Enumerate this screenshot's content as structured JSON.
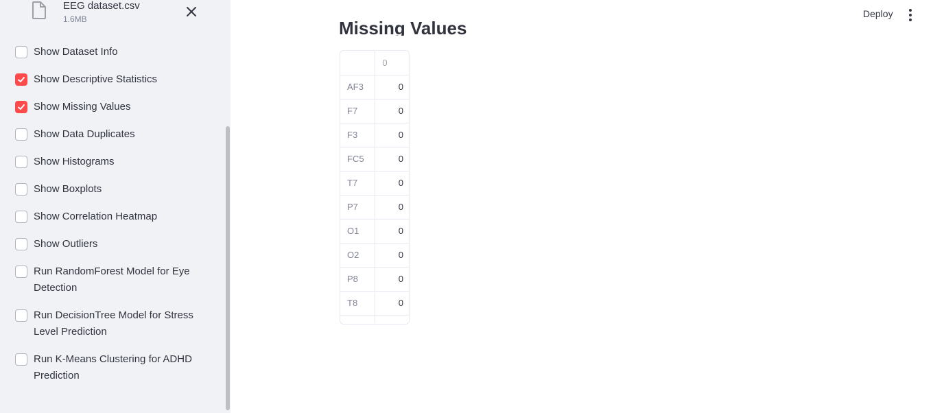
{
  "sidebar": {
    "file": {
      "name": "EEG dataset.csv",
      "size": "1.6MB"
    },
    "options": [
      {
        "label": "Show Dataset Info",
        "checked": false
      },
      {
        "label": "Show Descriptive Statistics",
        "checked": true
      },
      {
        "label": "Show Missing Values",
        "checked": true
      },
      {
        "label": "Show Data Duplicates",
        "checked": false
      },
      {
        "label": "Show Histograms",
        "checked": false
      },
      {
        "label": "Show Boxplots",
        "checked": false
      },
      {
        "label": "Show Correlation Heatmap",
        "checked": false
      },
      {
        "label": "Show Outliers",
        "checked": false
      },
      {
        "label": "Run RandomForest Model for Eye Detection",
        "checked": false
      },
      {
        "label": "Run DecisionTree Model for Stress Level Prediction",
        "checked": false
      },
      {
        "label": "Run K-Means Clustering for ADHD Prediction",
        "checked": false
      }
    ]
  },
  "header": {
    "deploy_label": "Deploy",
    "menu_icon": "kebab-menu-icon"
  },
  "main": {
    "section_title": "Missing Values",
    "table": {
      "column_header": "0",
      "rows": [
        {
          "index": "AF3",
          "value": "0"
        },
        {
          "index": "F7",
          "value": "0"
        },
        {
          "index": "F3",
          "value": "0"
        },
        {
          "index": "FC5",
          "value": "0"
        },
        {
          "index": "T7",
          "value": "0"
        },
        {
          "index": "P7",
          "value": "0"
        },
        {
          "index": "O1",
          "value": "0"
        },
        {
          "index": "O2",
          "value": "0"
        },
        {
          "index": "P8",
          "value": "0"
        },
        {
          "index": "T8",
          "value": "0"
        }
      ]
    }
  },
  "colors": {
    "accent": "#ff4b4b",
    "sidebar_bg": "#f0f2f6",
    "text": "#31333f"
  }
}
